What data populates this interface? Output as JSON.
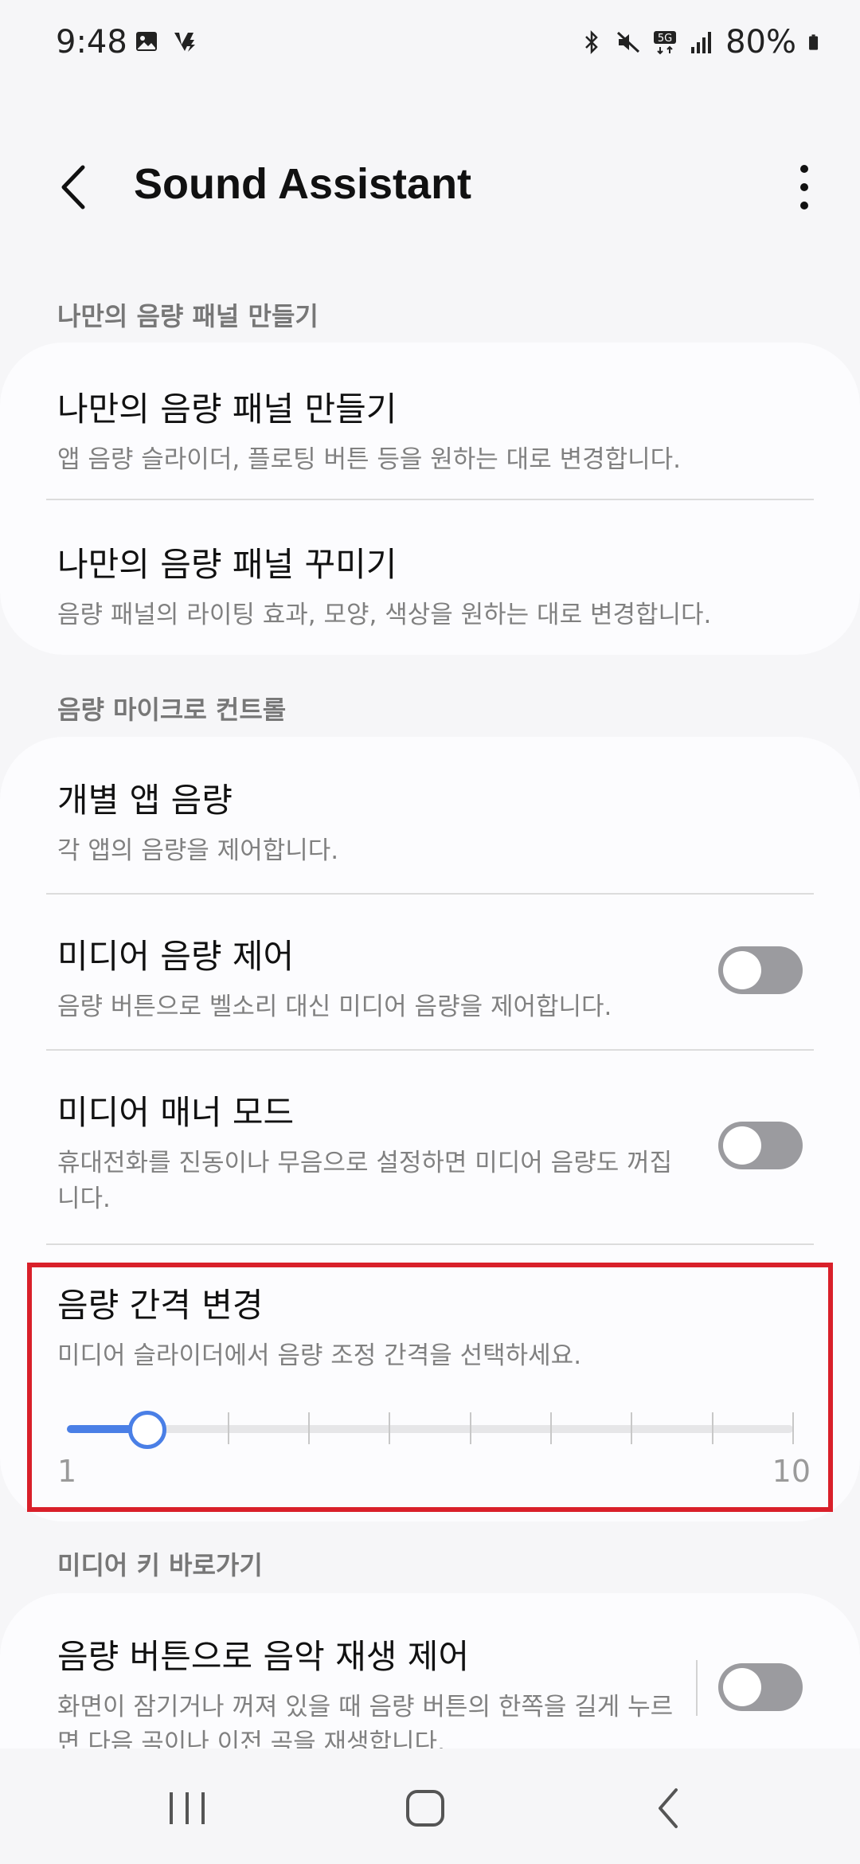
{
  "status": {
    "time": "9:48",
    "battery": "80%",
    "icons_left": [
      "image-icon",
      "app-notification-icon"
    ],
    "icons_right": [
      "bluetooth-icon",
      "mute-icon",
      "5g-icon",
      "signal-icon",
      "battery-icon"
    ]
  },
  "app_bar": {
    "title": "Sound Assistant",
    "back_icon": "back-arrow-icon",
    "more_icon": "more-options-icon"
  },
  "sections": {
    "panel": {
      "header": "나만의 음량 패널 만들기",
      "items": [
        {
          "title": "나만의 음량 패널 만들기",
          "subtitle": "앱 음량 슬라이더, 플로팅 버튼 등을 원하는 대로 변경합니다."
        },
        {
          "title": "나만의 음량 패널 꾸미기",
          "subtitle": "음량 패널의 라이팅 효과, 모양, 색상을 원하는 대로 변경합니다."
        }
      ]
    },
    "micro": {
      "header": "음량 마이크로 컨트롤",
      "items": [
        {
          "title": "개별 앱 음량",
          "subtitle": "각 앱의 음량을 제어합니다."
        },
        {
          "title": "미디어 음량 제어",
          "subtitle": "음량 버튼으로 벨소리 대신 미디어 음량을 제어합니다.",
          "toggle": false
        },
        {
          "title": "미디어 매너 모드",
          "subtitle": "휴대전화를 진동이나 무음으로 설정하면 미디어 음량도 꺼집니다.",
          "toggle": false
        }
      ],
      "step": {
        "title": "음량 간격 변경",
        "subtitle": "미디어 슬라이더에서 음량 조정 간격을 선택하세요.",
        "min_label": "1",
        "max_label": "10",
        "min": 1,
        "max": 10,
        "value": 2
      }
    },
    "media_keys": {
      "header": "미디어 키 바로가기",
      "items": [
        {
          "title": "음량 버튼으로 음악 재생 제어",
          "subtitle": "화면이 잠기거나 꺼져 있을 때 음량 버튼의 한쪽을 길게 누르면 다음 곡이나 이전 곡을 재생합니다.",
          "toggle": false
        }
      ]
    }
  },
  "colors": {
    "accent": "#4a7fe6",
    "highlight": "#d9202a",
    "toggle_off": "#9b9b9f"
  },
  "nav": {
    "icons": [
      "recent-apps-icon",
      "home-icon",
      "back-icon"
    ]
  }
}
